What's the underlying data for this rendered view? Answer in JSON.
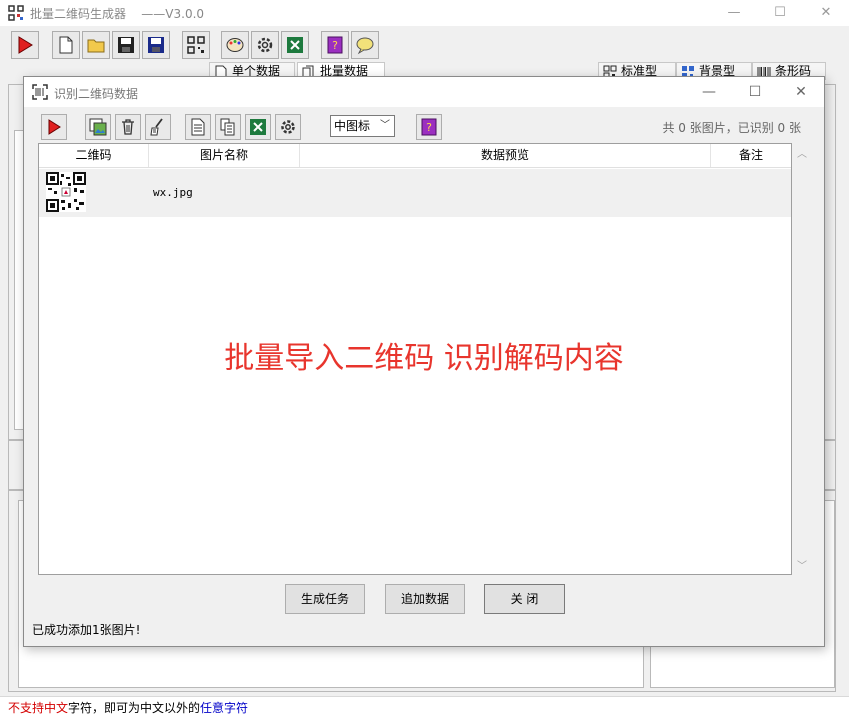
{
  "main": {
    "title": "批量二维码生成器",
    "version": "——V3.0.0",
    "tabs_left": [
      "单个数据",
      "批量数据"
    ],
    "tabs_right": [
      "标准型",
      "背景型",
      "条形码"
    ],
    "status": {
      "part1": "不支持中文",
      "part2": "字符，即可为中文以外的",
      "part3": "任意字符"
    }
  },
  "dialog": {
    "title": "识别二维码数据",
    "icon_size_select": "中图标",
    "count_text": "共 0 张图片，已识别 0 张",
    "columns": [
      "二维码",
      "图片名称",
      "数据预览",
      "备注"
    ],
    "rows": [
      {
        "filename": "wx.jpg",
        "preview": "",
        "note": ""
      }
    ],
    "banner": "批量导入二维码 识别解码内容",
    "buttons": {
      "generate": "生成任务",
      "append": "追加数据",
      "close": "关 闭"
    },
    "status": "已成功添加1张图片!"
  },
  "colors": {
    "banner": "#e8352d",
    "status_red": "#d40000",
    "status_blue": "#0000c8"
  }
}
